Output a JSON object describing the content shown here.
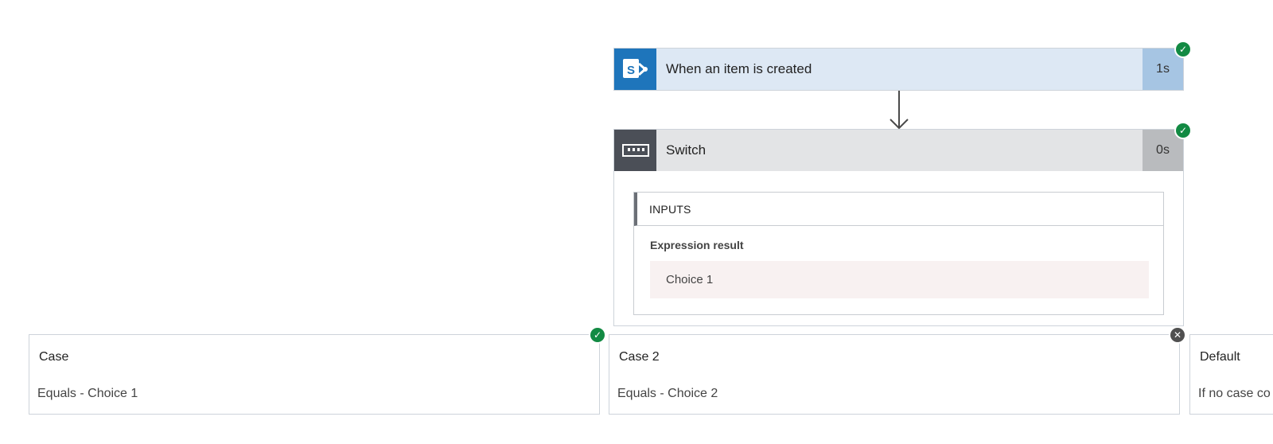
{
  "trigger": {
    "title": "When an item is created",
    "duration": "1s",
    "icon": "sharepoint-icon",
    "status": "succeeded"
  },
  "switch": {
    "title": "Switch",
    "duration": "0s",
    "icon": "switch-icon",
    "status": "succeeded",
    "inputs": {
      "header": "INPUTS",
      "expression_label": "Expression result",
      "expression_value": "Choice 1"
    }
  },
  "cases": [
    {
      "title": "Case",
      "condition": "Equals - Choice 1",
      "status": "succeeded"
    },
    {
      "title": "Case 2",
      "condition": "Equals - Choice 2",
      "status": "skipped"
    },
    {
      "title": "Default",
      "condition": "If no case co",
      "status": "none"
    }
  ],
  "colors": {
    "success": "#128a43",
    "skipped": "#505050",
    "trigger_accent": "#1e75bb",
    "switch_accent": "#4b4f57"
  }
}
